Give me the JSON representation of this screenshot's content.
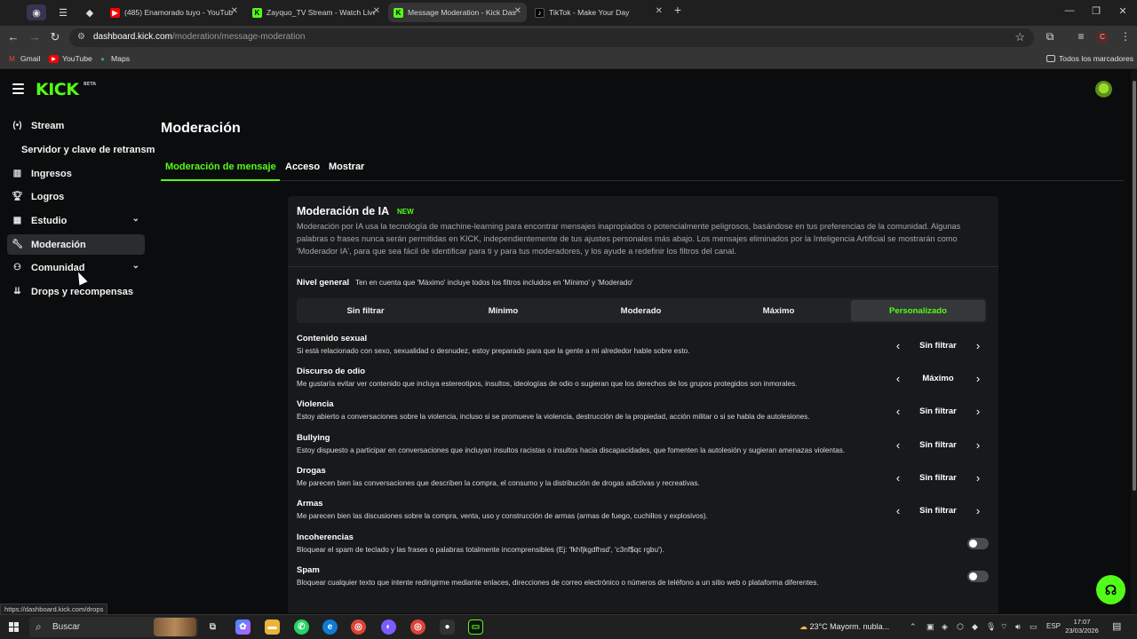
{
  "browser": {
    "tabs": [
      {
        "title": "(485) Enamorado tuyo - YouTub",
        "favicon": "youtube-icon",
        "active": false
      },
      {
        "title": "Zayquo_TV Stream - Watch Live",
        "favicon": "kick-icon",
        "active": false
      },
      {
        "title": "Message Moderation - Kick Das",
        "favicon": "kick-icon",
        "active": true
      },
      {
        "title": "TikTok - Make Your Day",
        "favicon": "tiktok-icon",
        "active": false
      }
    ],
    "url_host": "dashboard.kick.com",
    "url_path": "/moderation/message-moderation",
    "profile_initial": "C",
    "bookmarks": [
      "Gmail",
      "YouTube",
      "Maps"
    ],
    "all_bookmarks_label": "Todos los marcadores"
  },
  "sidebar": {
    "items": [
      {
        "label": "Stream",
        "icon": "broadcast-icon"
      },
      {
        "label": "Ingresos",
        "icon": "chart-icon"
      },
      {
        "label": "Logros",
        "icon": "trophy-icon"
      },
      {
        "label": "Estudio",
        "icon": "studio-icon"
      },
      {
        "label": "Moderación",
        "icon": "wrench-icon"
      },
      {
        "label": "Comunidad",
        "icon": "community-icon"
      },
      {
        "label": "Drops y recompensas",
        "icon": "drops-icon"
      }
    ],
    "sub_stream": "Servidor y clave de retransm"
  },
  "main": {
    "title": "Moderación",
    "tabs": [
      "Moderación de mensaje",
      "Acceso",
      "Mostrar"
    ],
    "card": {
      "title": "Moderación de IA",
      "badge": "NEW",
      "description": "Moderación por IA usa la tecnología de machine-learning para encontrar mensajes inapropiados o potencialmente peligrosos, basándose en tus preferencias de la comunidad. Algunas palabras o frases nunca serán permitidas en KICK, independientemente de tus ajustes personales más abajo. Los mensajes eliminados por la Inteligencia Artificial se mostrarán como 'Moderador IA', para que sea fácil de identificar para ti y para tus moderadores, y los ayude a redefinir los filtros del canal.",
      "level_label": "Nivel general",
      "level_hint": "Ten en cuenta que 'Máximo' incluye todos los filtros incluidos en 'Mínimo' y 'Moderado'",
      "levels": [
        "Sin filtrar",
        "Mínimo",
        "Moderado",
        "Máximo",
        "Personalizado"
      ],
      "active_level": "Personalizado",
      "rules": [
        {
          "title": "Contenido sexual",
          "desc": "Si está relacionado con sexo, sexualidad o desnudez, estoy preparado para que la gente a mi alrededor hable sobre esto.",
          "value": "Sin filtrar"
        },
        {
          "title": "Discurso de odio",
          "desc": "Me gustaría evitar ver contenido que incluya estereotipos, insultos, ideologías de odio o sugieran que los derechos de los grupos protegidos son inmorales.",
          "value": "Máximo"
        },
        {
          "title": "Violencia",
          "desc": "Estoy abierto a conversaciones sobre la violencia, incluso si se promueve la violencia, destrucción de la propiedad, acción militar o si se habla de autolesiones.",
          "value": "Sin filtrar"
        },
        {
          "title": "Bullying",
          "desc": "Estoy dispuesto a participar en conversaciones que incluyan insultos racistas o insultos hacia discapacidades, que fomenten la autolesión y sugieran amenazas violentas.",
          "value": "Sin filtrar"
        },
        {
          "title": "Drogas",
          "desc": "Me parecen bien las conversaciones que describen la compra, el consumo y la distribución de drogas adictivas y recreativas.",
          "value": "Sin filtrar"
        },
        {
          "title": "Armas",
          "desc": "Me parecen bien las discusiones sobre la compra, venta, uso y construcción de armas (armas de fuego, cuchillos y explosivos).",
          "value": "Sin filtrar"
        }
      ],
      "toggles": [
        {
          "title": "Incoherencias",
          "desc": "Bloquear el spam de teclado y las frases o palabras totalmente incomprensibles (Ej: 'fkhfjkgdfhsd', 'c3nf$qc rgbu').",
          "on": false
        },
        {
          "title": "Spam",
          "desc": "Bloquear cualquier texto que intente redirigirme mediante enlaces, direcciones de correo electrónico o números de teléfono a un sitio web o plataforma diferentes.",
          "on": false
        }
      ]
    }
  },
  "status_url": "https://dashboard.kick.com/drops",
  "taskbar": {
    "search_placeholder": "Buscar",
    "weather": "23°C  Mayorm. nubla...",
    "language": "ESP",
    "time": "17:07",
    "date": "23/03/2026"
  },
  "colors": {
    "accent": "#53fc18",
    "background": "#0b0c0d",
    "card": "#18191b"
  }
}
